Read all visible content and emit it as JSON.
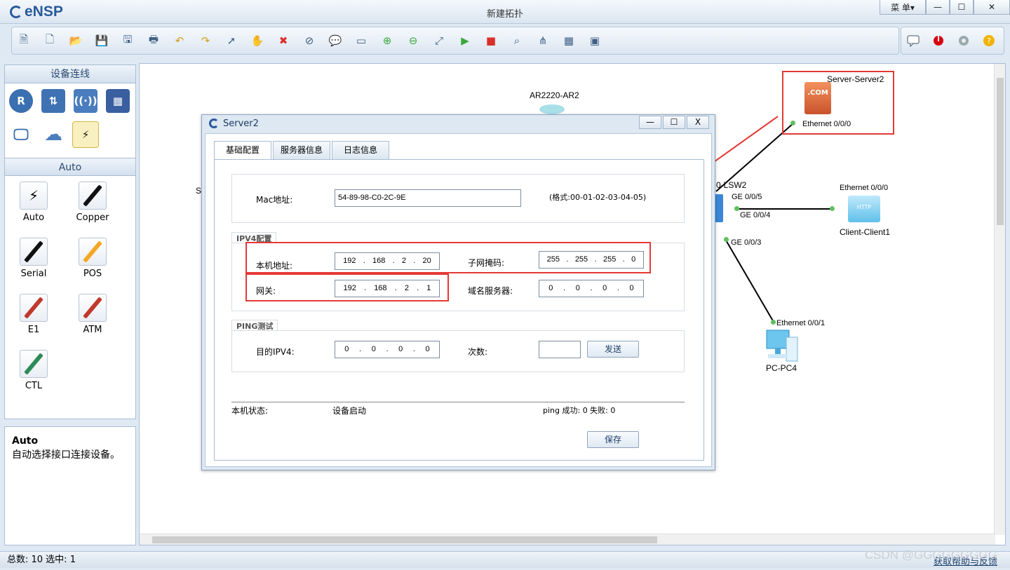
{
  "app": {
    "name": "eNSP",
    "window_title": "新建拓扑",
    "menu_label": "菜 单▾",
    "min": "—",
    "max": "☐",
    "close": "✕"
  },
  "toolbar": {
    "icons": [
      "new-topo-icon",
      "new-blank-icon",
      "open-icon",
      "save-icon",
      "save-as-icon",
      "print-icon",
      "undo-icon",
      "redo-icon",
      "select-icon",
      "hand-icon",
      "delete-icon",
      "delete-link-icon",
      "text-icon",
      "rectangle-icon",
      "zoom-in-icon",
      "zoom-out-icon",
      "fit-icon",
      "start-icon",
      "stop-icon",
      "capture-icon",
      "topology-icon",
      "grid-icon",
      "console-icon"
    ],
    "right_icons": [
      "message-icon",
      "huawei-icon",
      "settings-icon",
      "help-icon"
    ]
  },
  "left": {
    "devices_header": "设备连线",
    "auto_header": "Auto",
    "cables": [
      {
        "label": "Auto",
        "color": "#111"
      },
      {
        "label": "Copper",
        "color": "#111"
      },
      {
        "label": "Serial",
        "color": "#111"
      },
      {
        "label": "POS",
        "color": "#f5a623"
      },
      {
        "label": "E1",
        "color": "#c0392b"
      },
      {
        "label": "ATM",
        "color": "#c0392b"
      },
      {
        "label": "CTL",
        "color": "#2e8b57"
      }
    ],
    "desc_title": "Auto",
    "desc_text": "自动选择接口连接设备。"
  },
  "canvas": {
    "ar_label": "AR2220-AR2",
    "server_label": "Server-Server2",
    "server_port": "Ethernet 0/0/0",
    "lsw_label": "0-LSW2",
    "ge005": "GE 0/0/5",
    "ge004": "GE 0/0/4",
    "ge003": "GE 0/0/3",
    "client_port": "Ethernet 0/0/0",
    "client_label": "Client-Client1",
    "pc_port": "Ethernet 0/0/1",
    "pc_label": "PC-PC4",
    "partial_s": "S",
    "server_icon_text": ".COM",
    "client_icon_text": "HTTP"
  },
  "dialog": {
    "title": "Server2",
    "tabs": [
      "基础配置",
      "服务器信息",
      "日志信息"
    ],
    "mac_label": "Mac地址:",
    "mac_value": "54-89-98-C0-2C-9E",
    "mac_hint": "(格式:00-01-02-03-04-05)",
    "ipv4_group": "IPV4配置",
    "ip_label": "本机地址:",
    "ip": [
      "192",
      "168",
      "2",
      "20"
    ],
    "mask_label": "子网掩码:",
    "mask": [
      "255",
      "255",
      "255",
      "0"
    ],
    "gw_label": "网关:",
    "gw": [
      "192",
      "168",
      "2",
      "1"
    ],
    "dns_label": "域名服务器:",
    "dns": [
      "0",
      "0",
      "0",
      "0"
    ],
    "ping_group": "PING测试",
    "dst_label": "目的IPV4:",
    "dst": [
      "0",
      "0",
      "0",
      "0"
    ],
    "count_label": "次数:",
    "count_value": "",
    "send_btn": "发送",
    "state_label": "本机状态:",
    "state_value": "设备启动",
    "ping_result": "ping 成功: 0  失败: 0",
    "save_btn": "保存"
  },
  "status": {
    "text": "总数: 10  选中: 1",
    "help": "获取帮助与反馈",
    "watermark": "CSDN @GGGGGGGGG"
  }
}
